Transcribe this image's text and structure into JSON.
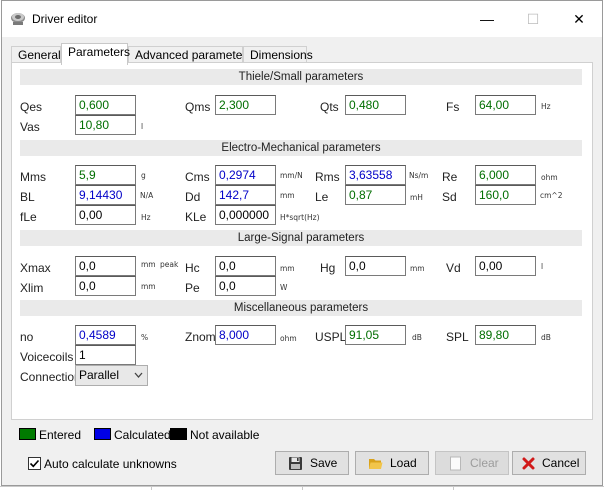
{
  "window": {
    "title": "Driver editor",
    "minimize_glyph": "—",
    "maximize_glyph": "☐",
    "close_glyph": "✕"
  },
  "tabs": [
    "General",
    "Parameters",
    "Advanced parameters",
    "Dimensions"
  ],
  "active_tab": "Parameters",
  "sections": {
    "ts": "Thiele/Small parameters",
    "em": "Electro-Mechanical parameters",
    "ls": "Large-Signal parameters",
    "misc": "Miscellaneous parameters"
  },
  "ts": {
    "qes": {
      "label": "Qes",
      "value": "0,600",
      "state": "entered"
    },
    "qms": {
      "label": "Qms",
      "value": "2,300",
      "state": "entered"
    },
    "qts": {
      "label": "Qts",
      "value": "0,480",
      "state": "entered"
    },
    "fs": {
      "label": "Fs",
      "value": "64,00",
      "unit": "Hz",
      "state": "entered"
    },
    "vas": {
      "label": "Vas",
      "value": "10,80",
      "unit": "l",
      "state": "entered"
    }
  },
  "em": {
    "mms": {
      "label": "Mms",
      "value": "5,9",
      "unit": "g",
      "state": "entered"
    },
    "cms": {
      "label": "Cms",
      "value": "0,2974",
      "unit": "mm/N",
      "state": "calculated"
    },
    "rms": {
      "label": "Rms",
      "value": "3,63558",
      "unit": "Ns/m",
      "state": "calculated"
    },
    "re": {
      "label": "Re",
      "value": "6,000",
      "unit": "ohm",
      "state": "entered"
    },
    "bl": {
      "label": "BL",
      "value": "9,14430",
      "unit": "N/A",
      "state": "calculated"
    },
    "dd": {
      "label": "Dd",
      "value": "142,7",
      "unit": "mm",
      "state": "calculated"
    },
    "le": {
      "label": "Le",
      "value": "0,87",
      "unit": "mH",
      "state": "entered"
    },
    "sd": {
      "label": "Sd",
      "value": "160,0",
      "unit": "cm^2",
      "state": "entered"
    },
    "fle": {
      "label": "fLe",
      "value": "0,00",
      "unit": "Hz",
      "state": "na"
    },
    "kle": {
      "label": "KLe",
      "value": "0,000000",
      "unit": "H*sqrt(Hz)",
      "state": "na"
    }
  },
  "ls": {
    "xmax": {
      "label": "Xmax",
      "value": "0,0",
      "unit": "mm",
      "unit2": "peak",
      "state": "na"
    },
    "hc": {
      "label": "Hc",
      "value": "0,0",
      "unit": "mm",
      "state": "na"
    },
    "hg": {
      "label": "Hg",
      "value": "0,0",
      "unit": "mm",
      "state": "na"
    },
    "vd": {
      "label": "Vd",
      "value": "0,00",
      "unit": "l",
      "state": "na"
    },
    "xlim": {
      "label": "Xlim",
      "value": "0,0",
      "unit": "mm",
      "state": "na"
    },
    "pe": {
      "label": "Pe",
      "value": "0,0",
      "unit": "W",
      "state": "na"
    }
  },
  "misc": {
    "no": {
      "label": "no",
      "value": "0,4589",
      "unit": "%",
      "state": "calculated"
    },
    "znom": {
      "label": "Znom",
      "value": "8,000",
      "unit": "ohm",
      "state": "calculated"
    },
    "uspl": {
      "label": "USPL",
      "value": "91,05",
      "unit": "dB",
      "state": "entered"
    },
    "spl": {
      "label": "SPL",
      "value": "89,80",
      "unit": "dB",
      "state": "entered"
    },
    "voicecoils": {
      "label": "Voicecoils",
      "value": "1"
    },
    "connection": {
      "label": "Connection",
      "value": "Parallel"
    }
  },
  "legend": {
    "entered": {
      "label": "Entered",
      "color": "#007a00"
    },
    "calculated": {
      "label": "Calculated",
      "color": "#0000e6"
    },
    "na": {
      "label": "Not available",
      "color": "#000000"
    }
  },
  "colors": {
    "entered_text": "#006e00",
    "calculated_text": "#0000c8"
  },
  "auto_calc": {
    "label": "Auto calculate unknowns",
    "checked": true
  },
  "buttons": {
    "save": "Save",
    "load": "Load",
    "clear": "Clear",
    "cancel": "Cancel"
  }
}
